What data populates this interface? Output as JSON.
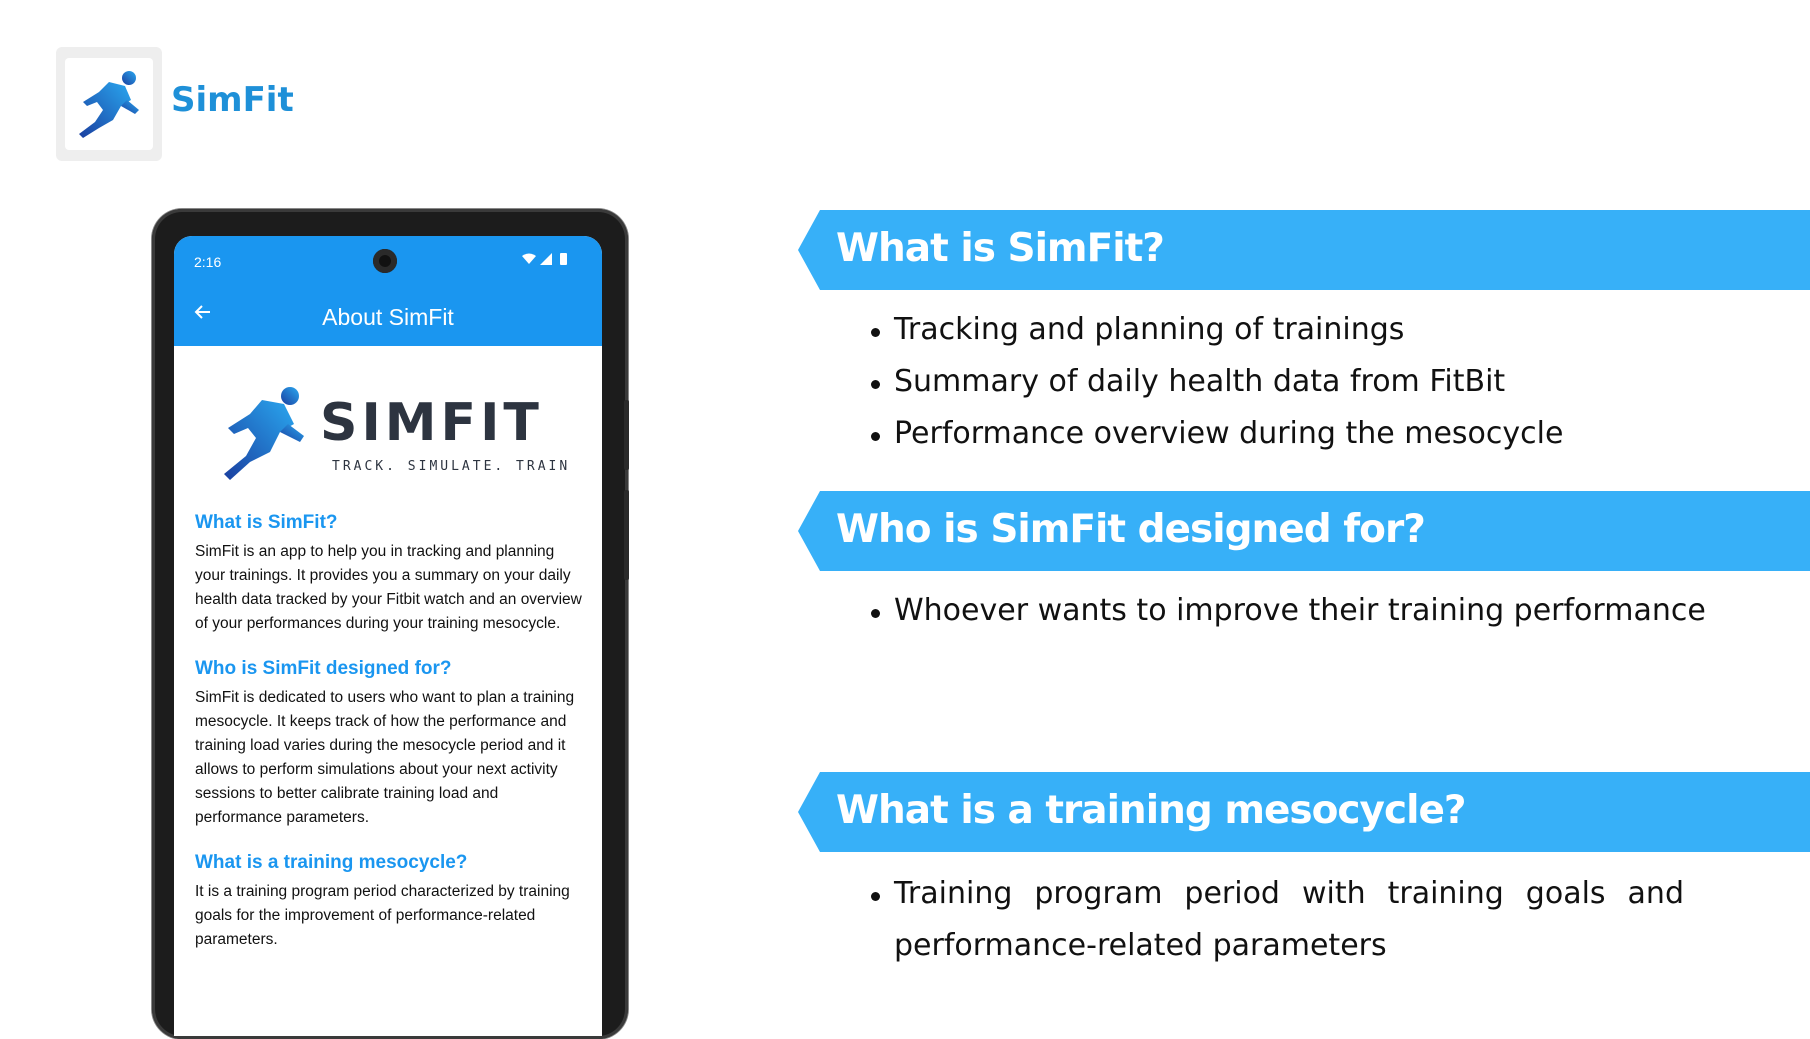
{
  "brand": {
    "name": "SimFit",
    "logo_icon": "runner-icon"
  },
  "phone": {
    "status_time": "2:16",
    "status_icons": "wifi-signal-battery-icons",
    "appbar_title": "About SimFit",
    "app_logo": {
      "wordmark": "SIMFIT",
      "tagline": "TRACK. SIMULATE. TRAIN."
    },
    "sections": [
      {
        "title": "What is SimFit?",
        "body": "SimFit is an app to help you in tracking and planning your trainings. It provides you a summary on your daily health data tracked by your Fitbit watch and an overview of your performances during your training mesocycle."
      },
      {
        "title": "Who is SimFit designed for?",
        "body": "SimFit is dedicated to users who want to plan a training mesocycle. It keeps track of how the performance and training load varies during the mesocycle period and it allows to perform simulations about your next activity sessions to better calibrate training load and performance parameters."
      },
      {
        "title": "What is a training mesocycle?",
        "body": "It is a training program period characterized by training goals for the improvement of performance-related parameters."
      }
    ]
  },
  "slides": [
    {
      "heading": "What is SimFit?",
      "bullets": [
        "Tracking and planning of trainings",
        "Summary of daily health data from FitBit",
        "Performance overview during the mesocycle"
      ]
    },
    {
      "heading": "Who is SimFit designed for?",
      "bullets": [
        "Whoever wants to improve their training performance"
      ]
    },
    {
      "heading": "What is a training mesocycle?",
      "bullets": [
        "Training program period with training goals and performance-related parameters"
      ]
    }
  ],
  "colors": {
    "accent": "#1a96f0",
    "banner": "#37b0f8",
    "brand_text": "#1e90d8"
  }
}
